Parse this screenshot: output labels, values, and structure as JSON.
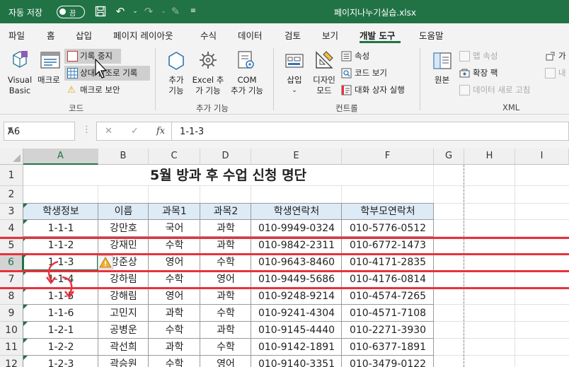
{
  "titlebar": {
    "autosave_label": "자동 저장",
    "toggle_label": "끔",
    "filename": "페이지나누기실습.xlsx"
  },
  "tabs": [
    {
      "label": "파일"
    },
    {
      "label": "홈"
    },
    {
      "label": "삽입"
    },
    {
      "label": "페이지 레이아웃"
    },
    {
      "label": "수식"
    },
    {
      "label": "데이터"
    },
    {
      "label": "검토"
    },
    {
      "label": "보기"
    },
    {
      "label": "개발 도구",
      "active": true
    },
    {
      "label": "도움말"
    }
  ],
  "ribbon": {
    "code": {
      "visual_basic": [
        "Visual",
        "Basic"
      ],
      "macro": "매크로",
      "stop_recording": "기록 중지",
      "relative_ref": "상대 참조로 기록",
      "macro_security": "매크로 보안",
      "group_label": "코드"
    },
    "addins": {
      "addins": [
        "추가",
        "기능"
      ],
      "excel_addins": [
        "Excel 추",
        "가 기능"
      ],
      "com_addins": [
        "COM",
        "추가 기능"
      ],
      "group_label": "추가 기능"
    },
    "controls": {
      "insert": "삽입",
      "design_mode": [
        "디자인",
        "모드"
      ],
      "properties": "속성",
      "view_code": "코드 보기",
      "run_dialog": "대화 상자 실행",
      "group_label": "컨트롤"
    },
    "xml": {
      "source": "원본",
      "map_properties": "맵 속성",
      "expansion_packs": "확장 팩",
      "refresh_data": "데이터 새로 고침",
      "import_partial": "가",
      "export_partial": "내",
      "group_label": "XML"
    }
  },
  "formula_bar": {
    "name_box": "A6",
    "value": "1-1-3",
    "fx": "fx"
  },
  "columns": [
    "A",
    "B",
    "C",
    "D",
    "E",
    "F",
    "G",
    "H",
    "I"
  ],
  "rows": [
    "1",
    "2",
    "3",
    "4",
    "5",
    "6",
    "7",
    "8",
    "9",
    "10",
    "11",
    "12"
  ],
  "sheet": {
    "title": "5월 방과 후 수업 신청 명단",
    "headers": [
      "학생정보",
      "이름",
      "과목1",
      "과목2",
      "학생연락처",
      "학부모연락처"
    ],
    "data": [
      [
        "1-1-1",
        "강만호",
        "국어",
        "과학",
        "010-9949-0324",
        "010-5776-0512"
      ],
      [
        "1-1-2",
        "강재민",
        "수학",
        "과학",
        "010-9842-2311",
        "010-6772-1473"
      ],
      [
        "1-1-3",
        "강준상",
        "영어",
        "수학",
        "010-9643-8460",
        "010-4171-2835"
      ],
      [
        "1-1-4",
        "강하림",
        "수학",
        "영어",
        "010-9449-5686",
        "010-4176-0814"
      ],
      [
        "1-1-5",
        "강해림",
        "영어",
        "과학",
        "010-9248-9214",
        "010-4574-7265"
      ],
      [
        "1-1-6",
        "고민지",
        "과학",
        "수학",
        "010-9241-4304",
        "010-4571-7108"
      ],
      [
        "1-2-1",
        "공병운",
        "수학",
        "과학",
        "010-9145-4440",
        "010-2271-3930"
      ],
      [
        "1-2-2",
        "곽선희",
        "과학",
        "수학",
        "010-9142-1891",
        "010-6377-1891"
      ],
      [
        "1-2-3",
        "곽승원",
        "수학",
        "영어",
        "010-9140-3351",
        "010-3479-0122"
      ]
    ]
  },
  "colors": {
    "excel_green": "#217346",
    "header_fill": "#ddebf7",
    "red_annotation": "#e8323c"
  }
}
